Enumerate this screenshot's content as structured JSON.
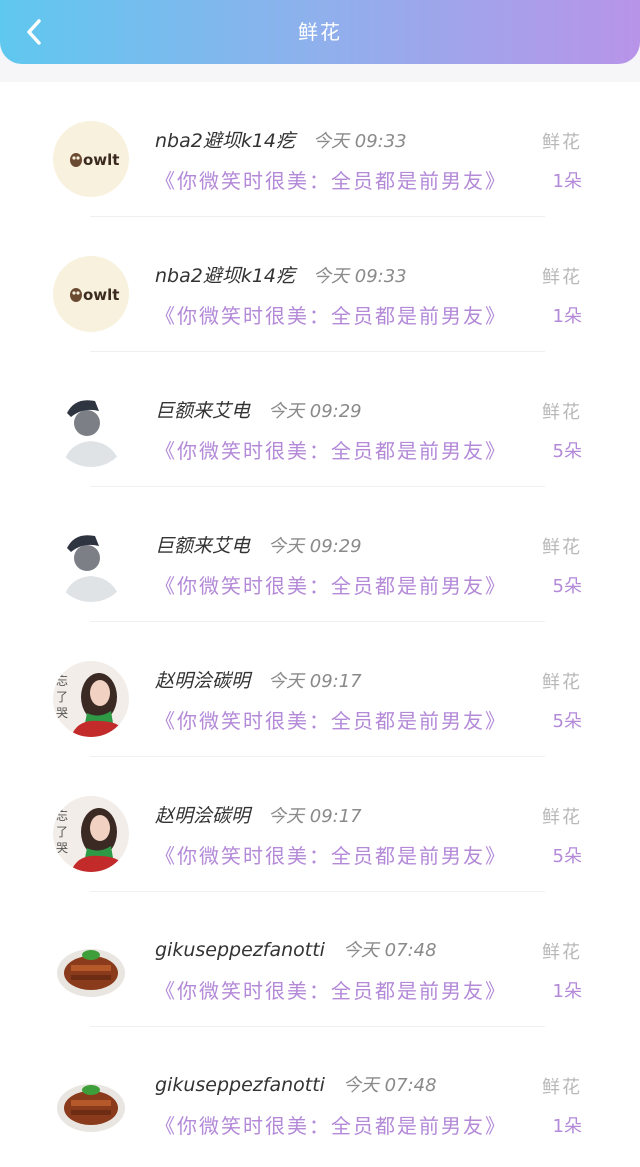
{
  "header": {
    "title": "鲜花",
    "back_icon": "chevron-left-icon"
  },
  "colors": {
    "header_start": "#5fc8ef",
    "header_end": "#b894e8",
    "accent": "#b389d8"
  },
  "rows": [
    {
      "avatar": "owl-logo",
      "avatar_text": "owlt",
      "username": "nba2避坝k14疙",
      "time": "今天 09:33",
      "message": "《你微笑时很美：全员都是前男友》",
      "gift": "鲜花",
      "count": "1朵"
    },
    {
      "avatar": "owl-logo",
      "avatar_text": "owlt",
      "username": "nba2避坝k14疙",
      "time": "今天 09:33",
      "message": "《你微笑时很美：全员都是前男友》",
      "gift": "鲜花",
      "count": "1朵"
    },
    {
      "avatar": "man-photo",
      "avatar_text": "",
      "username": "巨额来艾电",
      "time": "今天 09:29",
      "message": "《你微笑时很美：全员都是前男友》",
      "gift": "鲜花",
      "count": "5朵"
    },
    {
      "avatar": "man-photo",
      "avatar_text": "",
      "username": "巨额来艾电",
      "time": "今天 09:29",
      "message": "《你微笑时很美：全员都是前男友》",
      "gift": "鲜花",
      "count": "5朵"
    },
    {
      "avatar": "woman-photo",
      "avatar_text": "忘了哭",
      "username": "赵明浍碳明",
      "time": "今天 09:17",
      "message": "《你微笑时很美：全员都是前男友》",
      "gift": "鲜花",
      "count": "5朵"
    },
    {
      "avatar": "woman-photo",
      "avatar_text": "忘了哭",
      "username": "赵明浍碳明",
      "time": "今天 09:17",
      "message": "《你微笑时很美：全员都是前男友》",
      "gift": "鲜花",
      "count": "5朵"
    },
    {
      "avatar": "food-photo",
      "avatar_text": "",
      "username": "gikuseppezfanotti",
      "time": "今天 07:48",
      "message": "《你微笑时很美：全员都是前男友》",
      "gift": "鲜花",
      "count": "1朵"
    },
    {
      "avatar": "food-photo",
      "avatar_text": "",
      "username": "gikuseppezfanotti",
      "time": "今天 07:48",
      "message": "《你微笑时很美：全员都是前男友》",
      "gift": "鲜花",
      "count": "1朵"
    }
  ]
}
